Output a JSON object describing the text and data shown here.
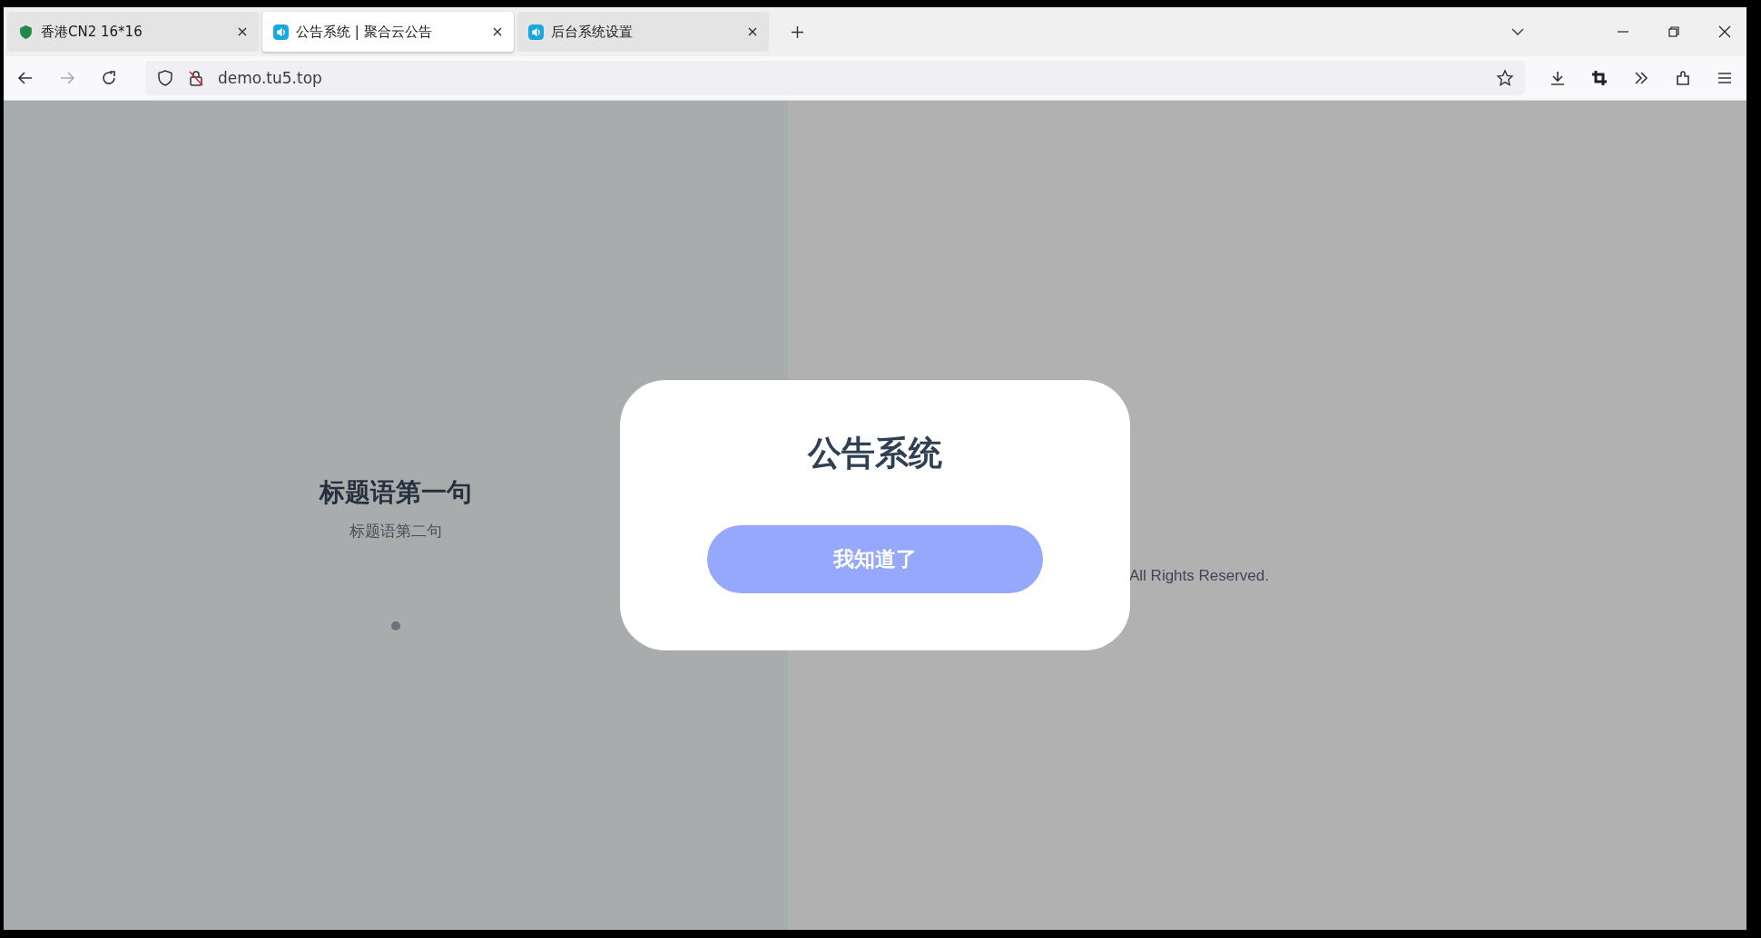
{
  "browser": {
    "tabs": [
      {
        "title": "香港CN2 16*16",
        "kind": "site",
        "selected": false
      },
      {
        "title": "公告系统 | 聚合云公告",
        "kind": "audio",
        "selected": true
      },
      {
        "title": "后台系统设置",
        "kind": "audio",
        "selected": false
      }
    ],
    "url": "demo.tu5.top"
  },
  "page": {
    "headline": "标题语第一句",
    "subheadline": "标题语第二句",
    "footer": "All Rights Reserved."
  },
  "modal": {
    "title": "公告系统",
    "button": "我知道了"
  }
}
